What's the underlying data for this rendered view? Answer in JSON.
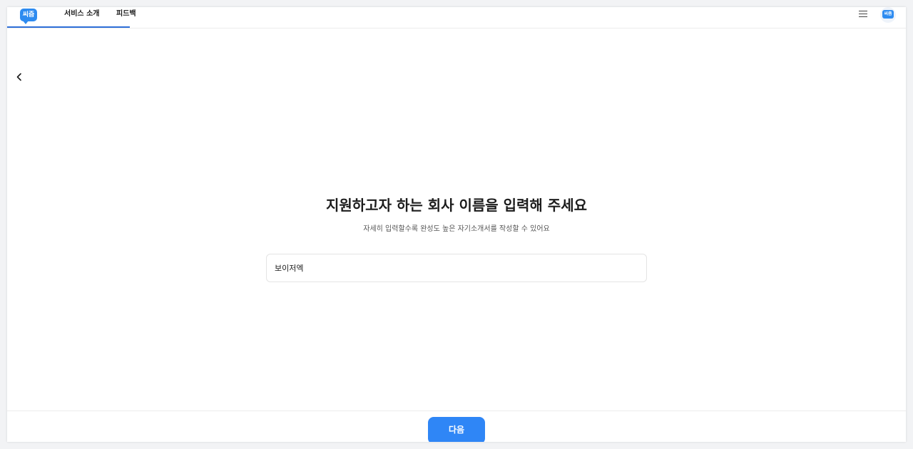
{
  "header": {
    "logo_text": "씨즘",
    "nav": [
      {
        "label": "서비스 소개"
      },
      {
        "label": "피드백"
      }
    ],
    "avatar_logo_text": "씨즘"
  },
  "main": {
    "title": "지원하고자 하는 회사 이름을 입력해 주세요",
    "subtitle": "자세히 입력할수록 완성도 높은 자기소개서를 작성할 수 있어요",
    "company_input_value": "보이저엑"
  },
  "footer": {
    "next_label": "다음"
  },
  "colors": {
    "accent": "#2f86f6",
    "nav_underline": "#2e6fd8"
  },
  "icons": {
    "menu": "hamburger-menu-icon",
    "back": "chevron-left-icon"
  }
}
